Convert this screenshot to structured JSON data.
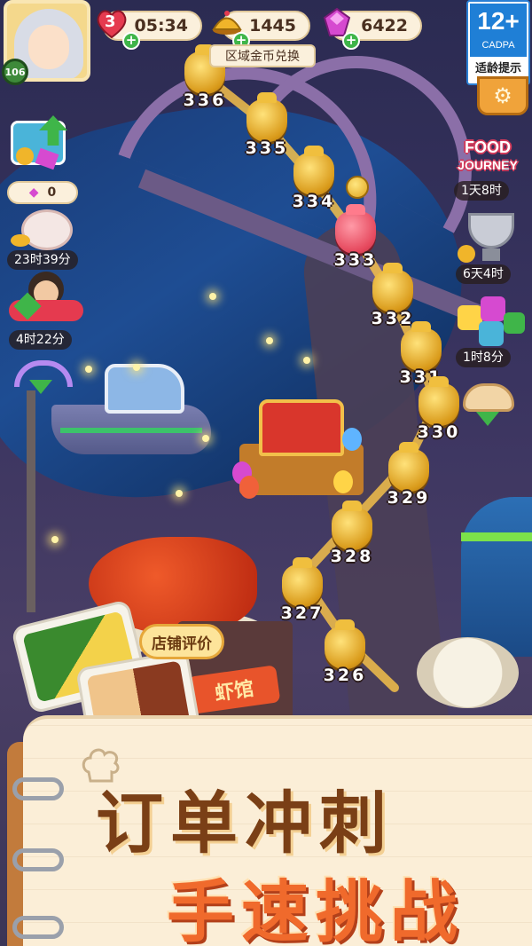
{
  "hud": {
    "player_level": "106",
    "lives": "3",
    "timer": "05:34",
    "coins": "1445",
    "gems": "6422",
    "exchange_label": "区域金币兑换"
  },
  "age_rating": {
    "age": "12+",
    "org": "CADPA",
    "tip": "适龄提示"
  },
  "left_events": {
    "piggy_gems": "0",
    "piggy_timer": "23时39分",
    "friends_timer": "4时22分"
  },
  "right_events": {
    "food_journey_line1": "FOOD",
    "food_journey_line2": "JOURNEY",
    "food_journey_timer": "1天8时",
    "trophy_timer": "6天4时",
    "puzzle_timer": "1时8分"
  },
  "levels": [
    {
      "num": "336",
      "state": "done"
    },
    {
      "num": "335",
      "state": "done"
    },
    {
      "num": "334",
      "state": "done"
    },
    {
      "num": "333",
      "state": "current"
    },
    {
      "num": "332",
      "state": "locked"
    },
    {
      "num": "331",
      "state": "locked"
    },
    {
      "num": "330",
      "state": "locked"
    },
    {
      "num": "329",
      "state": "locked"
    },
    {
      "num": "328",
      "state": "locked"
    },
    {
      "num": "327",
      "state": "locked"
    },
    {
      "num": "326",
      "state": "locked"
    }
  ],
  "restaurant": {
    "review_label": "店铺评价",
    "sign_text": "虾馆"
  },
  "promo": {
    "line1": "订单冲刺",
    "line2": "手速挑战"
  },
  "colors": {
    "heart": "#e53a4f",
    "coin": "#f0b52a",
    "gem": "#d64ad0",
    "plus": "#3fb549",
    "current_level": "#e5475c"
  }
}
